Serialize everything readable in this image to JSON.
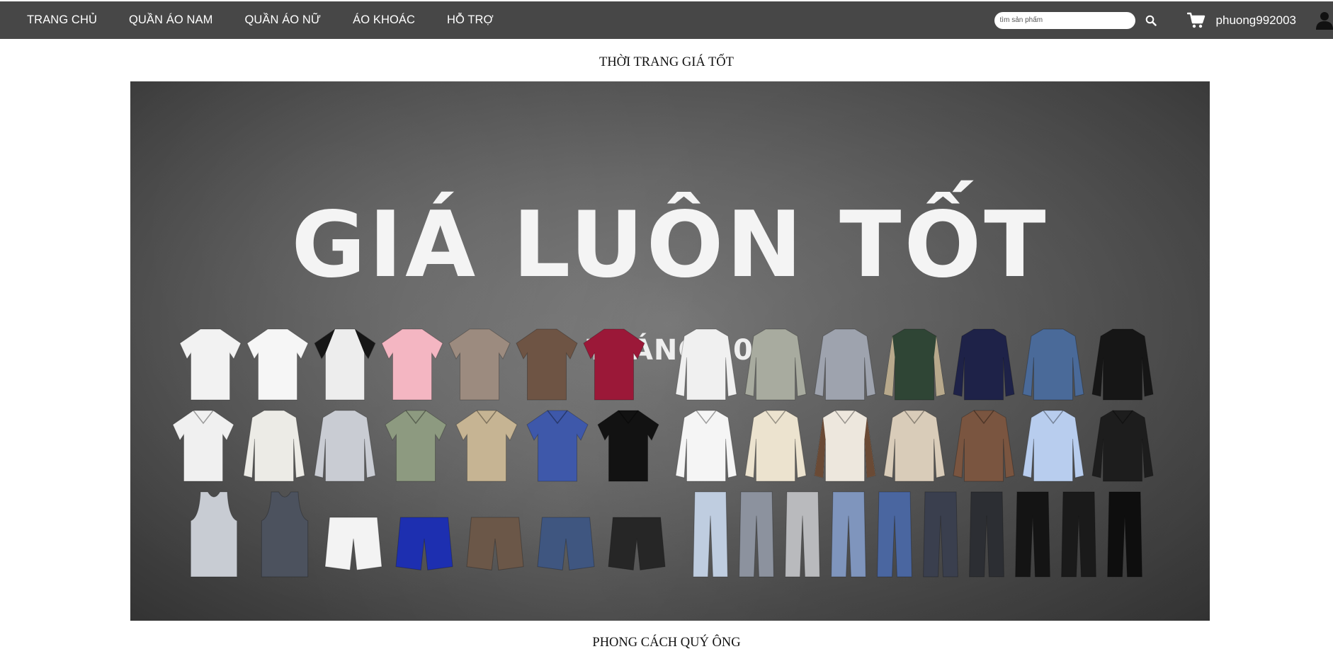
{
  "nav": {
    "links": [
      "TRANG CHỦ",
      "QUẦN ÁO NAM",
      "QUẦN ÁO NỮ",
      "ÁO KHOÁC",
      "HỖ TRỢ"
    ],
    "search_placeholder": "tìm sản phẩm",
    "search_icon": "search-icon",
    "cart_icon": "cart-icon",
    "username": "phuong992003",
    "user_icon": "user-icon"
  },
  "sections": {
    "top_title": "THỜI TRANG GIÁ TỐT",
    "bottom_title": "PHONG CÁCH QUÝ ÔNG"
  },
  "banner": {
    "headline": "GIÁ LUÔN TỐT",
    "subheadline": "THÁNG 10",
    "rows": [
      {
        "kind": "tops",
        "items": [
          {
            "type": "tee",
            "color": "#f2f2f2"
          },
          {
            "type": "tee",
            "color": "#f6f6f6"
          },
          {
            "type": "tee",
            "color": "#ededed",
            "sleeve": "#161616"
          },
          {
            "type": "tee",
            "color": "#f4b6c2"
          },
          {
            "type": "tee",
            "color": "#9c8b7f"
          },
          {
            "type": "tee",
            "color": "#6e5444"
          },
          {
            "type": "tee",
            "color": "#9b1838"
          },
          {
            "type": "hoodie",
            "color": "#f0f0f0"
          },
          {
            "type": "hoodie",
            "color": "#a8ab9f"
          },
          {
            "type": "hoodie",
            "color": "#9ea3ae"
          },
          {
            "type": "jacket",
            "color": "#2f4535",
            "sleeve": "#b8a98c"
          },
          {
            "type": "hoodie",
            "color": "#1e2248"
          },
          {
            "type": "jacket",
            "color": "#4a6a99"
          },
          {
            "type": "jacket",
            "color": "#161616"
          }
        ]
      },
      {
        "kind": "shirts",
        "items": [
          {
            "type": "polo",
            "color": "#f0f0f0"
          },
          {
            "type": "longsleeve",
            "color": "#ecebe6"
          },
          {
            "type": "longsleeve",
            "color": "#c9ccd3"
          },
          {
            "type": "polo",
            "color": "#8d9a80"
          },
          {
            "type": "polo",
            "color": "#c6b493"
          },
          {
            "type": "polo",
            "color": "#3e58aa"
          },
          {
            "type": "polo",
            "color": "#121212"
          },
          {
            "type": "shirt",
            "color": "#f5f5f5"
          },
          {
            "type": "shirt",
            "color": "#ece3cf"
          },
          {
            "type": "shirt",
            "color": "#ede7dd",
            "sleeve": "#6a4a35"
          },
          {
            "type": "shirt",
            "color": "#d9ccb9"
          },
          {
            "type": "shirt",
            "color": "#7a5540"
          },
          {
            "type": "shirt",
            "color": "#b8cdee"
          },
          {
            "type": "shirt",
            "color": "#1d1d1d"
          }
        ]
      },
      {
        "kind": "bottoms",
        "items": [
          {
            "type": "tank",
            "color": "#c8ccd3"
          },
          {
            "type": "tank",
            "color": "#4c525e"
          },
          {
            "type": "shorts",
            "color": "#f3f3f3"
          },
          {
            "type": "shorts",
            "color": "#1d2fb0"
          },
          {
            "type": "shorts",
            "color": "#6b5748"
          },
          {
            "type": "shorts",
            "color": "#3f5680"
          },
          {
            "type": "shorts",
            "color": "#262626"
          },
          {
            "type": "pants",
            "color": "#bfcde0"
          },
          {
            "type": "pants",
            "color": "#8c929e"
          },
          {
            "type": "pants",
            "color": "#b9babd"
          },
          {
            "type": "pants",
            "color": "#7f95bd"
          },
          {
            "type": "pants",
            "color": "#4a66a0"
          },
          {
            "type": "pants",
            "color": "#3a3f4e"
          },
          {
            "type": "pants",
            "color": "#2c2e33"
          },
          {
            "type": "pants",
            "color": "#141414"
          },
          {
            "type": "pants",
            "color": "#1a1a1a"
          },
          {
            "type": "pants",
            "color": "#0e0e0e"
          }
        ]
      }
    ]
  }
}
